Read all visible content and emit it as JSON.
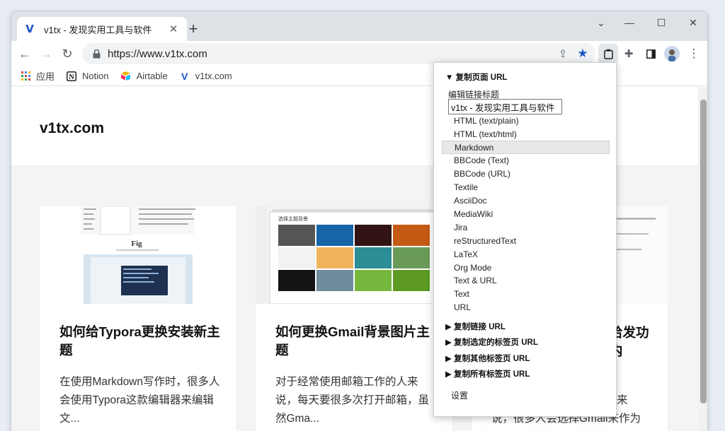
{
  "tab": {
    "favicon": "V",
    "title": "v1tx - 发现实用工具与软件"
  },
  "toolbar": {
    "url": "https://www.v1tx.com"
  },
  "bookmarks": [
    {
      "icon": "apps-grid-icon",
      "label": "应用"
    },
    {
      "icon": "notion-icon",
      "label": "Notion"
    },
    {
      "icon": "airtable-icon",
      "label": "Airtable"
    },
    {
      "icon": "v1tx-icon",
      "label": "v1tx.com"
    }
  ],
  "site": {
    "title": "v1tx.com"
  },
  "cards": [
    {
      "title": "如何给Typora更换安装新主题",
      "desc": "在使用Markdown写作时，很多人会使用Typora这款编辑器来编辑文...",
      "fig_label": "Fig"
    },
    {
      "title": "如何更换Gmail背景图片主题",
      "desc": "对于经常使用邮箱工作的人来说，每天要很多次打开邮箱，虽然Gma...",
      "dialog_title": "选择主题背景"
    },
    {
      "title_partial_1": "给发功",
      "title_partial_2": "内",
      "desc_partial_1": "来",
      "desc_partial_2": "说，很多人会选择Gmail来作为"
    }
  ],
  "popup": {
    "section_main": "▼ 复制页面 URL",
    "edit_label": "编辑链接标题",
    "title_value": "v1tx - 发现实用工具与软件",
    "formats": [
      "HTML (text/plain)",
      "HTML (text/html)",
      "Markdown",
      "BBCode (Text)",
      "BBCode (URL)",
      "Textile",
      "AsciiDoc",
      "MediaWiki",
      "Jira",
      "reStructuredText",
      "LaTeX",
      "Org Mode",
      "Text & URL",
      "Text",
      "URL"
    ],
    "selected_format": "Markdown",
    "sections": [
      "▶ 复制链接 URL",
      "▶ 复制选定的标签页 URL",
      "▶ 复制其他标签页 URL",
      "▶ 复制所有标签页 URL"
    ],
    "settings": "设置"
  },
  "colors": {
    "accent": "#1a73e8",
    "star": "#1a56c8"
  }
}
